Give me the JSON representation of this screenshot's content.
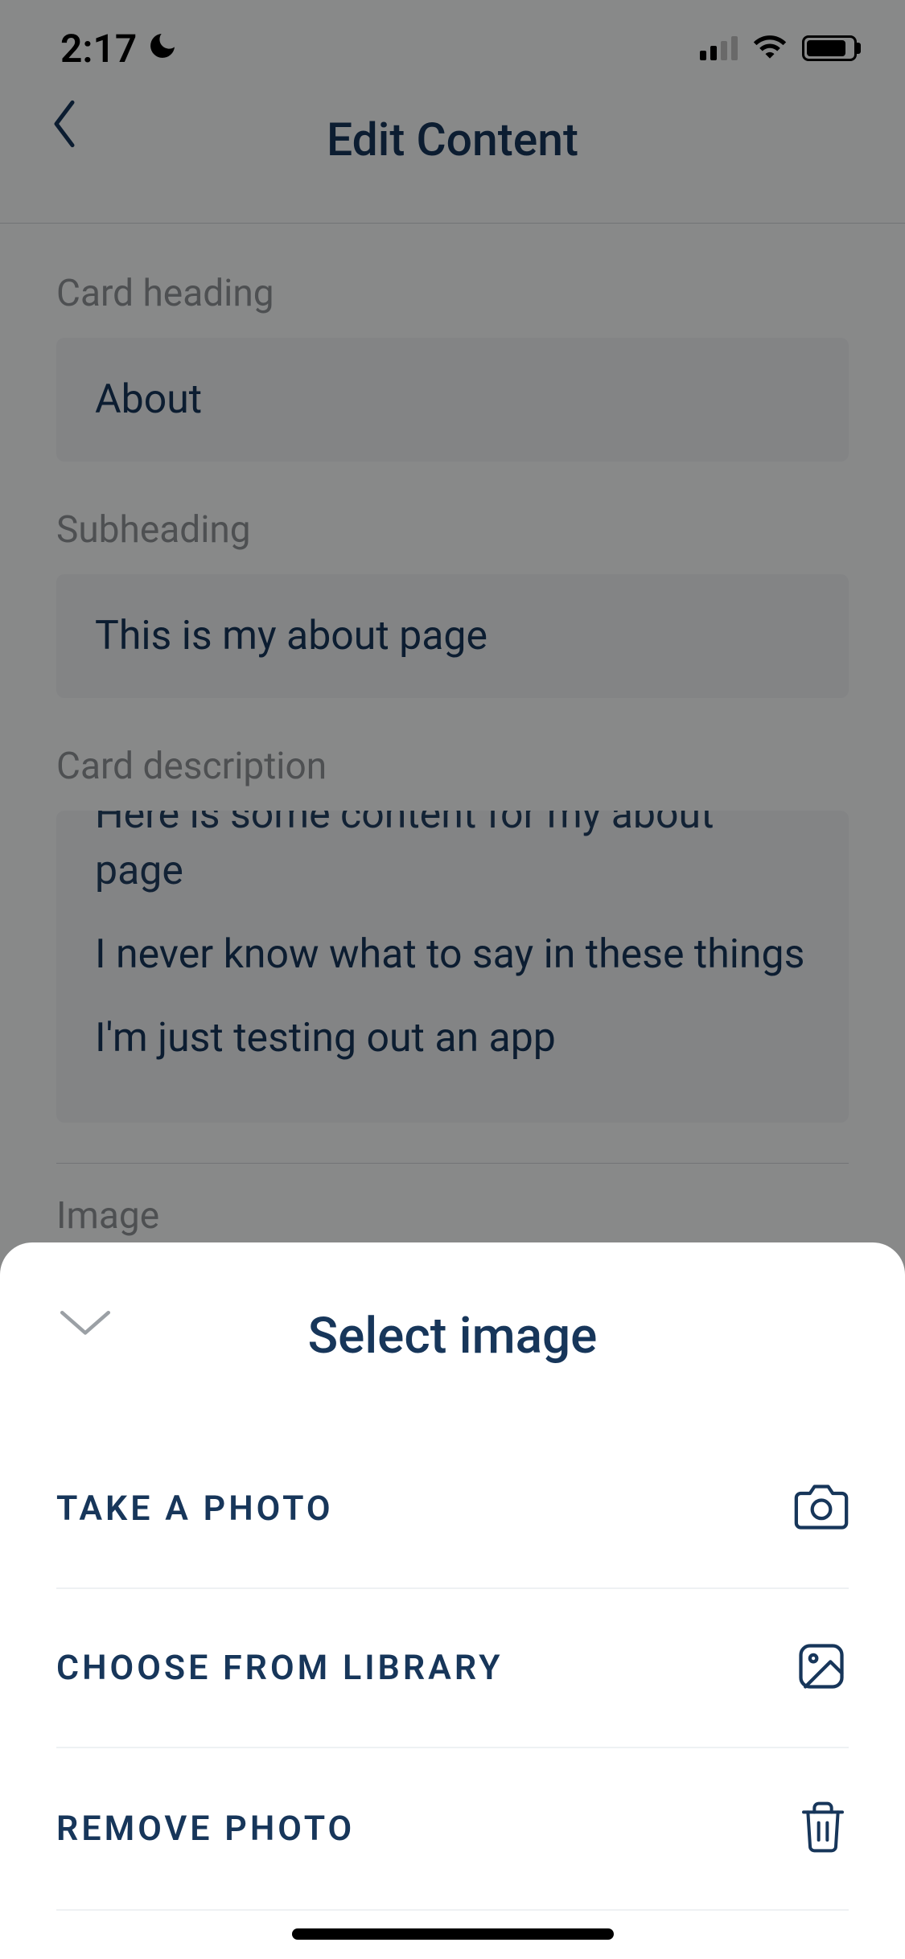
{
  "status": {
    "time": "2:17"
  },
  "header": {
    "title": "Edit Content"
  },
  "form": {
    "heading_label": "Card heading",
    "heading_value": "About",
    "subheading_label": "Subheading",
    "subheading_value": "This is my about page",
    "description_label": "Card description",
    "description_lines": {
      "line0": "Here is some content for my about page",
      "line1": "I never know what to say in these things",
      "line2": "I'm just testing out an app"
    },
    "image_label": "Image"
  },
  "sheet": {
    "title": "Select image",
    "options": {
      "take": "TAKE A PHOTO",
      "choose": "CHOOSE FROM LIBRARY",
      "remove": "REMOVE PHOTO"
    }
  }
}
